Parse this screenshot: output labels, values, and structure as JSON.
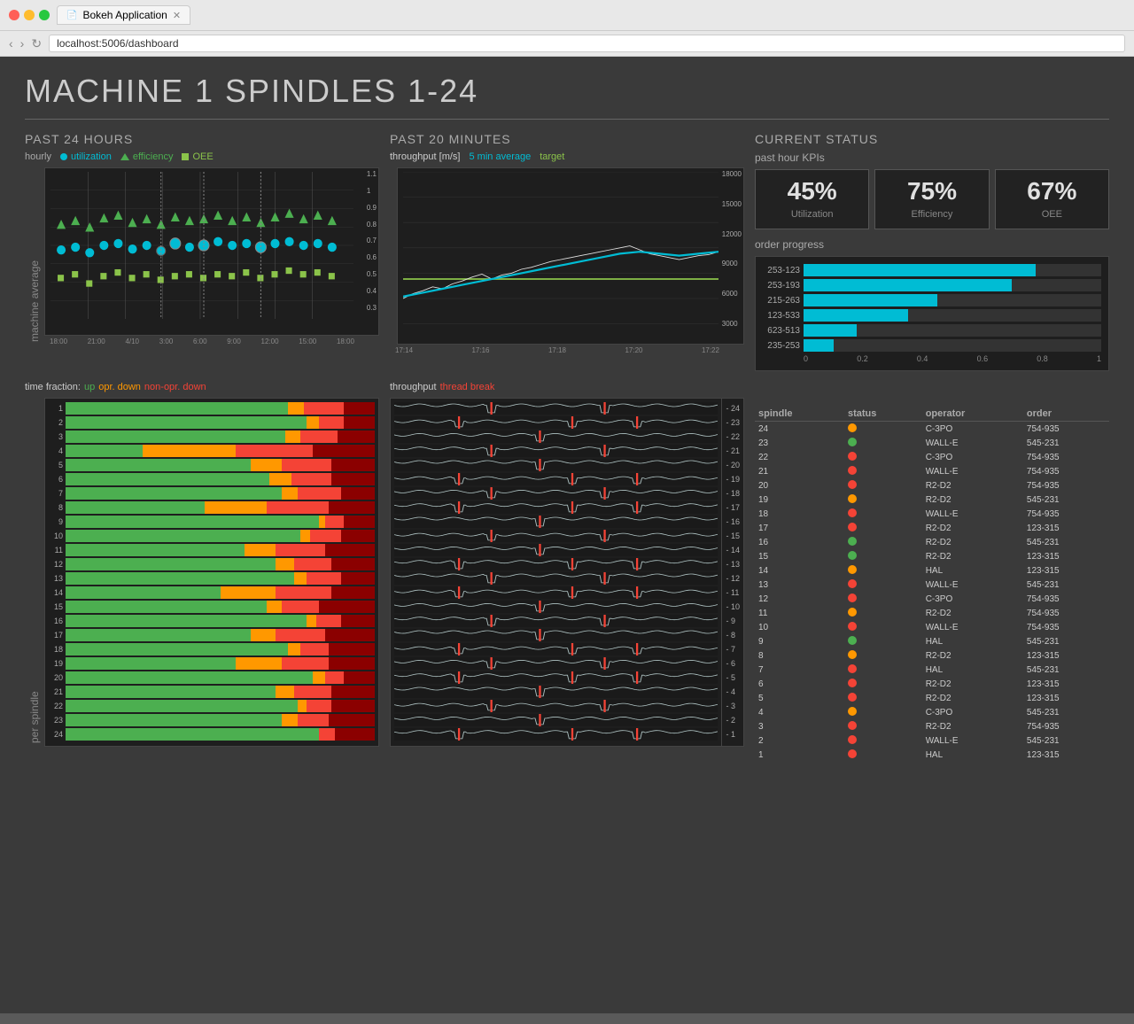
{
  "browser": {
    "tab_title": "Bokeh Application",
    "url": "localhost:5006/dashboard"
  },
  "page": {
    "title": "MACHINE 1 SPINDLES 1-24"
  },
  "past24": {
    "section_title": "PAST 24 HOURS",
    "legend": {
      "hourly": "hourly",
      "utilization": "utilization",
      "efficiency": "efficiency",
      "oee": "OEE"
    },
    "x_labels": [
      "18:00",
      "21:00",
      "4/10",
      "3:00",
      "6:00",
      "9:00",
      "12:00",
      "15:00",
      "18:00"
    ],
    "y_labels": [
      "1.1",
      "1",
      "0.9",
      "0.8",
      "0.7",
      "0.6",
      "0.5",
      "0.4",
      "0.3"
    ]
  },
  "past20": {
    "section_title": "PAST 20 MINUTES",
    "legend": {
      "throughput": "throughput [m/s]",
      "avg": "5 min average",
      "target": "target"
    },
    "y_labels": [
      "18000",
      "15000",
      "12000",
      "9000",
      "6000",
      "3000",
      ""
    ],
    "x_labels": [
      "17:14",
      "17:16",
      "17:18",
      "17:20",
      "17:22"
    ]
  },
  "current_status": {
    "section_title": "CURRENT STATUS",
    "kpis_label": "past hour KPIs",
    "kpis": [
      {
        "value": "45%",
        "label": "Utilization"
      },
      {
        "value": "75%",
        "label": "Efficiency"
      },
      {
        "value": "67%",
        "label": "OEE"
      }
    ],
    "order_progress_label": "order progress",
    "orders": [
      {
        "id": "253-123",
        "pct": 0.78
      },
      {
        "id": "253-193",
        "pct": 0.7
      },
      {
        "id": "215-263",
        "pct": 0.45
      },
      {
        "id": "123-533",
        "pct": 0.35
      },
      {
        "id": "623-513",
        "pct": 0.18
      },
      {
        "id": "235-253",
        "pct": 0.1
      }
    ],
    "order_axis": [
      "0",
      "0.2",
      "0.4",
      "0.6",
      "0.8",
      "1"
    ]
  },
  "bottom_section": {
    "left_label": "per spindle",
    "time_fraction": {
      "title": "time fraction:",
      "legend": {
        "up": "up",
        "opr_down": "opr. down",
        "non_opr_down": "non-opr. down"
      }
    },
    "throughput_label": "throughput",
    "thread_break_label": "thread break"
  },
  "spindle_table": {
    "headers": [
      "spindle",
      "status",
      "operator",
      "order"
    ],
    "rows": [
      {
        "spindle": "24",
        "status": "orange",
        "operator": "C-3PO",
        "order": "754-935"
      },
      {
        "spindle": "23",
        "status": "green",
        "operator": "WALL-E",
        "order": "545-231"
      },
      {
        "spindle": "22",
        "status": "red",
        "operator": "C-3PO",
        "order": "754-935"
      },
      {
        "spindle": "21",
        "status": "red",
        "operator": "WALL-E",
        "order": "754-935"
      },
      {
        "spindle": "20",
        "status": "red",
        "operator": "R2-D2",
        "order": "754-935"
      },
      {
        "spindle": "19",
        "status": "orange",
        "operator": "R2-D2",
        "order": "545-231"
      },
      {
        "spindle": "18",
        "status": "red",
        "operator": "WALL-E",
        "order": "754-935"
      },
      {
        "spindle": "17",
        "status": "red",
        "operator": "R2-D2",
        "order": "123-315"
      },
      {
        "spindle": "16",
        "status": "green",
        "operator": "R2-D2",
        "order": "545-231"
      },
      {
        "spindle": "15",
        "status": "green",
        "operator": "R2-D2",
        "order": "123-315"
      },
      {
        "spindle": "14",
        "status": "orange",
        "operator": "HAL",
        "order": "123-315"
      },
      {
        "spindle": "13",
        "status": "red",
        "operator": "WALL-E",
        "order": "545-231"
      },
      {
        "spindle": "12",
        "status": "red",
        "operator": "C-3PO",
        "order": "754-935"
      },
      {
        "spindle": "11",
        "status": "orange",
        "operator": "R2-D2",
        "order": "754-935"
      },
      {
        "spindle": "10",
        "status": "red",
        "operator": "WALL-E",
        "order": "754-935"
      },
      {
        "spindle": "9",
        "status": "green",
        "operator": "HAL",
        "order": "545-231"
      },
      {
        "spindle": "8",
        "status": "orange",
        "operator": "R2-D2",
        "order": "123-315"
      },
      {
        "spindle": "7",
        "status": "red",
        "operator": "HAL",
        "order": "545-231"
      },
      {
        "spindle": "6",
        "status": "red",
        "operator": "R2-D2",
        "order": "123-315"
      },
      {
        "spindle": "5",
        "status": "red",
        "operator": "R2-D2",
        "order": "123-315"
      },
      {
        "spindle": "4",
        "status": "orange",
        "operator": "C-3PO",
        "order": "545-231"
      },
      {
        "spindle": "3",
        "status": "red",
        "operator": "R2-D2",
        "order": "754-935"
      },
      {
        "spindle": "2",
        "status": "red",
        "operator": "WALL-E",
        "order": "545-231"
      },
      {
        "spindle": "1",
        "status": "red",
        "operator": "HAL",
        "order": "123-315"
      }
    ]
  },
  "stacked_bars": [
    {
      "num": 24,
      "green": 82,
      "orange": 0,
      "red": 5,
      "darkred": 13
    },
    {
      "num": 23,
      "green": 70,
      "orange": 5,
      "red": 10,
      "darkred": 15
    },
    {
      "num": 22,
      "green": 75,
      "orange": 3,
      "red": 8,
      "darkred": 14
    },
    {
      "num": 21,
      "green": 68,
      "orange": 6,
      "red": 12,
      "darkred": 14
    },
    {
      "num": 20,
      "green": 80,
      "orange": 4,
      "red": 6,
      "darkred": 10
    },
    {
      "num": 19,
      "green": 55,
      "orange": 15,
      "red": 15,
      "darkred": 15
    },
    {
      "num": 18,
      "green": 72,
      "orange": 4,
      "red": 9,
      "darkred": 15
    },
    {
      "num": 17,
      "green": 60,
      "orange": 8,
      "red": 16,
      "darkred": 16
    },
    {
      "num": 16,
      "green": 78,
      "orange": 3,
      "red": 8,
      "darkred": 11
    },
    {
      "num": 15,
      "green": 65,
      "orange": 5,
      "red": 12,
      "darkred": 18
    },
    {
      "num": 14,
      "green": 50,
      "orange": 18,
      "red": 18,
      "darkred": 14
    },
    {
      "num": 13,
      "green": 74,
      "orange": 4,
      "red": 11,
      "darkred": 11
    },
    {
      "num": 12,
      "green": 68,
      "orange": 6,
      "red": 12,
      "darkred": 14
    },
    {
      "num": 11,
      "green": 58,
      "orange": 10,
      "red": 16,
      "darkred": 16
    },
    {
      "num": 10,
      "green": 76,
      "orange": 3,
      "red": 10,
      "darkred": 11
    },
    {
      "num": 9,
      "green": 82,
      "orange": 2,
      "red": 6,
      "darkred": 10
    },
    {
      "num": 8,
      "green": 45,
      "orange": 20,
      "red": 20,
      "darkred": 15
    },
    {
      "num": 7,
      "green": 70,
      "orange": 5,
      "red": 14,
      "darkred": 11
    },
    {
      "num": 6,
      "green": 66,
      "orange": 7,
      "red": 13,
      "darkred": 14
    },
    {
      "num": 5,
      "green": 60,
      "orange": 10,
      "red": 16,
      "darkred": 14
    },
    {
      "num": 4,
      "green": 25,
      "orange": 30,
      "red": 25,
      "darkred": 20
    },
    {
      "num": 3,
      "green": 71,
      "orange": 5,
      "red": 12,
      "darkred": 12
    },
    {
      "num": 2,
      "green": 78,
      "orange": 4,
      "red": 8,
      "darkred": 10
    },
    {
      "num": 1,
      "green": 72,
      "orange": 5,
      "red": 13,
      "darkred": 10
    }
  ]
}
